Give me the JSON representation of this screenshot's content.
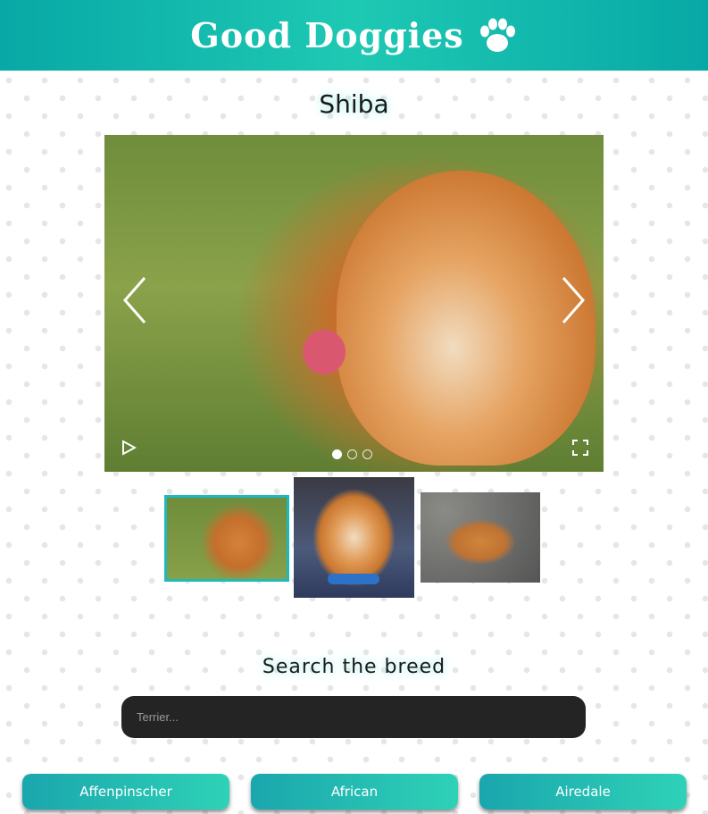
{
  "header": {
    "title": "Good Doggies",
    "icon": "paw-icon"
  },
  "gallery": {
    "title": "Shiba",
    "slide_count": 3,
    "active_slide": 1,
    "controls": {
      "prev": "chevron-left-icon",
      "next": "chevron-right-icon",
      "play": "play-icon",
      "fullscreen": "fullscreen-icon"
    }
  },
  "search": {
    "title": "Search the breed",
    "placeholder": "Terrier...",
    "value": ""
  },
  "breeds": [
    "Affenpinscher",
    "African",
    "Airedale"
  ],
  "colors": {
    "accent": "#1eb9bc",
    "header_start": "#08a8a6",
    "header_end": "#1ec9b3",
    "input_bg": "#242424"
  }
}
